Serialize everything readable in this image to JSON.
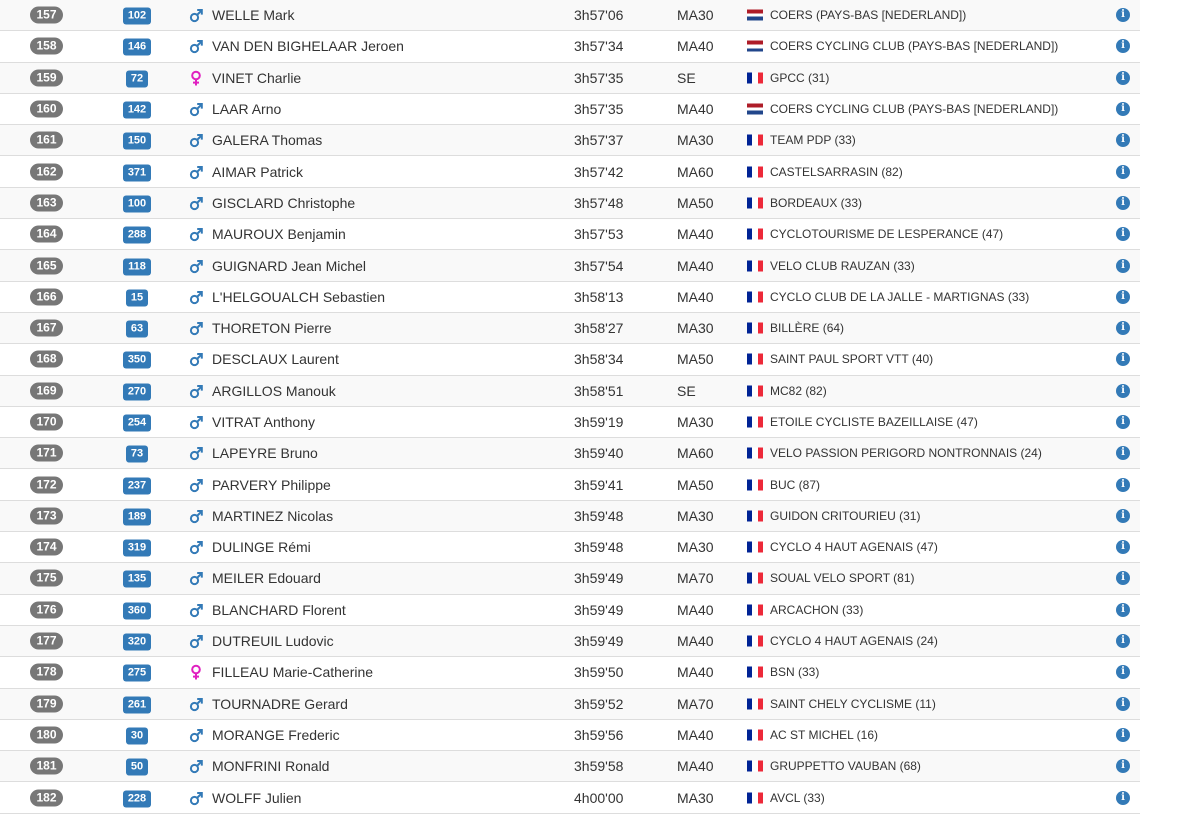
{
  "colors": {
    "rank_badge": "#777777",
    "bib_badge": "#337ab7",
    "male_icon": "#337ab7",
    "female_icon": "#e020c0",
    "info_icon": "#337ab7",
    "row_stripe": "#f9f9f9"
  },
  "icons": {
    "male": "male-symbol-icon",
    "female": "female-symbol-icon",
    "info": "info-circle-icon",
    "flag_nl": "netherlands-flag-icon",
    "flag_fr": "france-flag-icon"
  },
  "info_glyph": "i",
  "rows": [
    {
      "rank": "157",
      "bib": "102",
      "gender": "M",
      "name": "WELLE Mark",
      "time": "3h57'06",
      "category": "MA30",
      "country": "NL",
      "club": "COERS (PAYS-BAS [NEDERLAND])"
    },
    {
      "rank": "158",
      "bib": "146",
      "gender": "M",
      "name": "VAN DEN BIGHELAAR Jeroen",
      "time": "3h57'34",
      "category": "MA40",
      "country": "NL",
      "club": "COERS CYCLING CLUB (PAYS-BAS [NEDERLAND])"
    },
    {
      "rank": "159",
      "bib": "72",
      "gender": "F",
      "name": "VINET Charlie",
      "time": "3h57'35",
      "category": "SE",
      "country": "FR",
      "club": "GPCC (31)"
    },
    {
      "rank": "160",
      "bib": "142",
      "gender": "M",
      "name": "LAAR Arno",
      "time": "3h57'35",
      "category": "MA40",
      "country": "NL",
      "club": "COERS CYCLING CLUB (PAYS-BAS [NEDERLAND])"
    },
    {
      "rank": "161",
      "bib": "150",
      "gender": "M",
      "name": "GALERA Thomas",
      "time": "3h57'37",
      "category": "MA30",
      "country": "FR",
      "club": "TEAM PDP (33)"
    },
    {
      "rank": "162",
      "bib": "371",
      "gender": "M",
      "name": "AIMAR Patrick",
      "time": "3h57'42",
      "category": "MA60",
      "country": "FR",
      "club": "CASTELSARRASIN (82)"
    },
    {
      "rank": "163",
      "bib": "100",
      "gender": "M",
      "name": "GISCLARD Christophe",
      "time": "3h57'48",
      "category": "MA50",
      "country": "FR",
      "club": "BORDEAUX (33)"
    },
    {
      "rank": "164",
      "bib": "288",
      "gender": "M",
      "name": "MAUROUX Benjamin",
      "time": "3h57'53",
      "category": "MA40",
      "country": "FR",
      "club": "CYCLOTOURISME DE LESPERANCE (47)"
    },
    {
      "rank": "165",
      "bib": "118",
      "gender": "M",
      "name": "GUIGNARD Jean Michel",
      "time": "3h57'54",
      "category": "MA40",
      "country": "FR",
      "club": "VELO CLUB RAUZAN (33)"
    },
    {
      "rank": "166",
      "bib": "15",
      "gender": "M",
      "name": "L'HELGOUALCH Sebastien",
      "time": "3h58'13",
      "category": "MA40",
      "country": "FR",
      "club": "CYCLO CLUB DE LA JALLE - MARTIGNAS (33)"
    },
    {
      "rank": "167",
      "bib": "63",
      "gender": "M",
      "name": "THORETON Pierre",
      "time": "3h58'27",
      "category": "MA30",
      "country": "FR",
      "club": "BILLÈRE (64)"
    },
    {
      "rank": "168",
      "bib": "350",
      "gender": "M",
      "name": "DESCLAUX Laurent",
      "time": "3h58'34",
      "category": "MA50",
      "country": "FR",
      "club": "SAINT PAUL SPORT VTT (40)"
    },
    {
      "rank": "169",
      "bib": "270",
      "gender": "M",
      "name": "ARGILLOS Manouk",
      "time": "3h58'51",
      "category": "SE",
      "country": "FR",
      "club": "MC82 (82)"
    },
    {
      "rank": "170",
      "bib": "254",
      "gender": "M",
      "name": "VITRAT Anthony",
      "time": "3h59'19",
      "category": "MA30",
      "country": "FR",
      "club": "ETOILE CYCLISTE BAZEILLAISE (47)"
    },
    {
      "rank": "171",
      "bib": "73",
      "gender": "M",
      "name": "LAPEYRE Bruno",
      "time": "3h59'40",
      "category": "MA60",
      "country": "FR",
      "club": "VELO PASSION PERIGORD NONTRONNAIS (24)"
    },
    {
      "rank": "172",
      "bib": "237",
      "gender": "M",
      "name": "PARVERY Philippe",
      "time": "3h59'41",
      "category": "MA50",
      "country": "FR",
      "club": "BUC (87)"
    },
    {
      "rank": "173",
      "bib": "189",
      "gender": "M",
      "name": "MARTINEZ Nicolas",
      "time": "3h59'48",
      "category": "MA30",
      "country": "FR",
      "club": "GUIDON CRITOURIEU (31)"
    },
    {
      "rank": "174",
      "bib": "319",
      "gender": "M",
      "name": "DULINGE Rémi",
      "time": "3h59'48",
      "category": "MA30",
      "country": "FR",
      "club": "CYCLO 4 HAUT AGENAIS (47)"
    },
    {
      "rank": "175",
      "bib": "135",
      "gender": "M",
      "name": "MEILER Edouard",
      "time": "3h59'49",
      "category": "MA70",
      "country": "FR",
      "club": "SOUAL VELO SPORT (81)"
    },
    {
      "rank": "176",
      "bib": "360",
      "gender": "M",
      "name": "BLANCHARD Florent",
      "time": "3h59'49",
      "category": "MA40",
      "country": "FR",
      "club": "ARCACHON (33)"
    },
    {
      "rank": "177",
      "bib": "320",
      "gender": "M",
      "name": "DUTREUIL Ludovic",
      "time": "3h59'49",
      "category": "MA40",
      "country": "FR",
      "club": "CYCLO 4 HAUT AGENAIS (24)"
    },
    {
      "rank": "178",
      "bib": "275",
      "gender": "F",
      "name": "FILLEAU Marie-Catherine",
      "time": "3h59'50",
      "category": "MA40",
      "country": "FR",
      "club": "BSN (33)"
    },
    {
      "rank": "179",
      "bib": "261",
      "gender": "M",
      "name": "TOURNADRE Gerard",
      "time": "3h59'52",
      "category": "MA70",
      "country": "FR",
      "club": "SAINT CHELY CYCLISME (11)"
    },
    {
      "rank": "180",
      "bib": "30",
      "gender": "M",
      "name": "MORANGE Frederic",
      "time": "3h59'56",
      "category": "MA40",
      "country": "FR",
      "club": "AC ST MICHEL (16)"
    },
    {
      "rank": "181",
      "bib": "50",
      "gender": "M",
      "name": "MONFRINI Ronald",
      "time": "3h59'58",
      "category": "MA40",
      "country": "FR",
      "club": "GRUPPETTO VAUBAN (68)"
    },
    {
      "rank": "182",
      "bib": "228",
      "gender": "M",
      "name": "WOLFF Julien",
      "time": "4h00'00",
      "category": "MA30",
      "country": "FR",
      "club": "AVCL (33)"
    }
  ]
}
